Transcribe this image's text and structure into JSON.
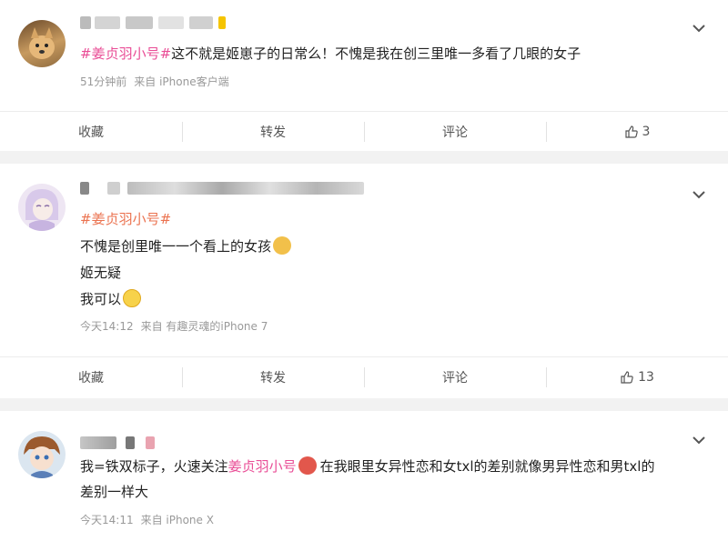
{
  "posts": [
    {
      "tag": "#姜贞羽小号#",
      "text_lines": [
        "这不就是姬崽子的日常么！不愧是我在创三里唯一多看了几眼的女子"
      ],
      "time": "51分钟前",
      "source": "来自 iPhone客户端",
      "actions": {
        "collect": "收藏",
        "forward": "转发",
        "comment": "评论",
        "likes": "3"
      }
    },
    {
      "tag": "#姜贞羽小号#",
      "text_lines": [
        "不愧是创里唯一一个看上的女孩",
        "姬无疑",
        "我可以"
      ],
      "time": "今天14:12",
      "source": "来自 有趣灵魂的iPhone 7",
      "actions": {
        "collect": "收藏",
        "forward": "转发",
        "comment": "评论",
        "likes": "13"
      }
    },
    {
      "text_prefix": "我=铁双标子，火速关注",
      "tag": "姜贞羽小号",
      "text_suffix": "在我眼里女异性恋和女txl的差别就像男异性恋和男txl的",
      "text_line2": "差别一样大",
      "time": "今天14:11",
      "source": "来自 iPhone X"
    }
  ],
  "icons": [
    "chevron-down-icon",
    "thumbs-up-icon",
    "doge-emoji",
    "grin-emoji",
    "angry-emoji"
  ],
  "colors": {
    "tag_orange": "#eb7350",
    "tag_pink": "#e94d96",
    "meta": "#999999"
  }
}
